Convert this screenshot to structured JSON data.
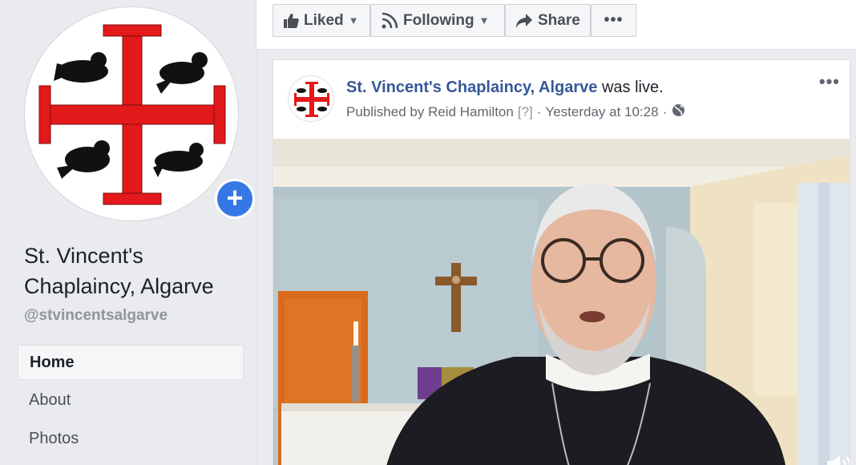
{
  "page": {
    "name": "St. Vincent's Chaplaincy, Algarve",
    "handle": "@stvincentsalgarve",
    "profile_icon": "jerusalem-cross-with-birds",
    "add_photo_icon": "plus-icon"
  },
  "nav": {
    "items": [
      {
        "label": "Home",
        "active": true
      },
      {
        "label": "About",
        "active": false
      },
      {
        "label": "Photos",
        "active": false
      }
    ]
  },
  "actions": {
    "liked": {
      "label": "Liked",
      "icon": "thumbs-up-icon"
    },
    "following": {
      "label": "Following",
      "icon": "rss-icon"
    },
    "share": {
      "label": "Share",
      "icon": "share-arrow-icon"
    },
    "more": {
      "label": "•••"
    }
  },
  "post": {
    "author": "St. Vincent's Chaplaincy, Algarve",
    "action_text": "was live.",
    "published_by": "Published by Reid Hamilton",
    "help_marker": "[?]",
    "separator": "·",
    "timestamp": "Yesterday at 10:28",
    "audience_icon": "globe-icon",
    "more": "•••",
    "video_volume_icon": "volume-icon"
  },
  "colors": {
    "link": "#365899",
    "accent": "#3578e5",
    "cross_red": "#e3191b"
  }
}
